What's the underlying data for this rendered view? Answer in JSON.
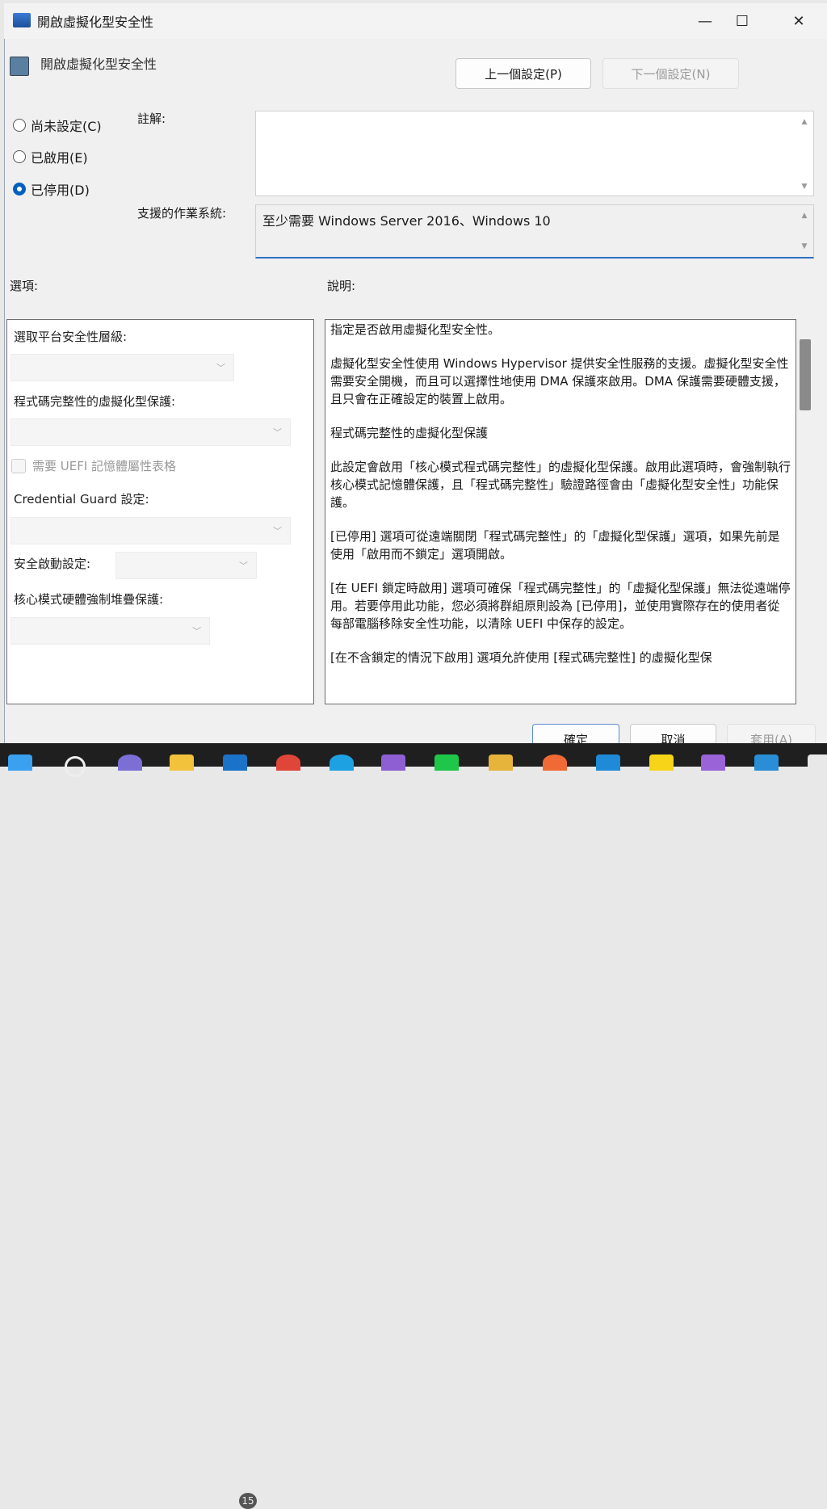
{
  "window": {
    "title": "開啟虛擬化型安全性",
    "minimize": "—",
    "maximize": "☐",
    "close": "✕"
  },
  "heading": "開啟虛擬化型安全性",
  "nav": {
    "prev": "上一個設定(P)",
    "next": "下一個設定(N)"
  },
  "state": {
    "options": [
      {
        "label": "尚未設定(C)",
        "checked": false
      },
      {
        "label": "已啟用(E)",
        "checked": false
      },
      {
        "label": "已停用(D)",
        "checked": true
      }
    ]
  },
  "comment": {
    "label": "註解:",
    "value": ""
  },
  "supported": {
    "label": "支援的作業系統:",
    "value": "至少需要 Windows Server 2016、Windows 10"
  },
  "options_header": "選項:",
  "help_header": "說明:",
  "options": {
    "platform_label": "選取平台安全性層級:",
    "code_integrity_label": "程式碼完整性的虛擬化型保護:",
    "uefi_checkbox": "需要 UEFI 記憶體屬性表格",
    "credential_guard_label": "Credential Guard 設定:",
    "secure_launch_label": "安全啟動設定:",
    "stack_protection_label": "核心模式硬體強制堆疊保護:"
  },
  "help": [
    "指定是否啟用虛擬化型安全性。",
    "虛擬化型安全性使用 Windows Hypervisor 提供安全性服務的支援。虛擬化型安全性需要安全開機，而且可以選擇性地使用 DMA 保護來啟用。DMA 保護需要硬體支援，且只會在正確設定的裝置上啟用。",
    "程式碼完整性的虛擬化型保護",
    "此設定會啟用「核心模式程式碼完整性」的虛擬化型保護。啟用此選項時，會強制執行核心模式記憶體保護，且「程式碼完整性」驗證路徑會由「虛擬化型安全性」功能保護。",
    "[已停用] 選項可從遠端關閉「程式碼完整性」的「虛擬化型保護」選項，如果先前是使用「啟用而不鎖定」選項開啟。",
    "[在 UEFI 鎖定時啟用] 選項可確保「程式碼完整性」的「虛擬化型保護」無法從遠端停用。若要停用此功能，您必須將群組原則設為 [已停用]，並使用實際存在的使用者從每部電腦移除安全性功能，以清除 UEFI 中保存的設定。",
    "[在不含鎖定的情況下啟用] 選項允許使用 [程式碼完整性] 的虛擬化型保"
  ],
  "buttons": {
    "ok": "確定",
    "cancel": "取消",
    "apply": "套用(A)"
  },
  "taskbar": {
    "badge": "15"
  },
  "colors": {
    "accent": "#0060c0",
    "taskbar": "#1f1f1f"
  }
}
